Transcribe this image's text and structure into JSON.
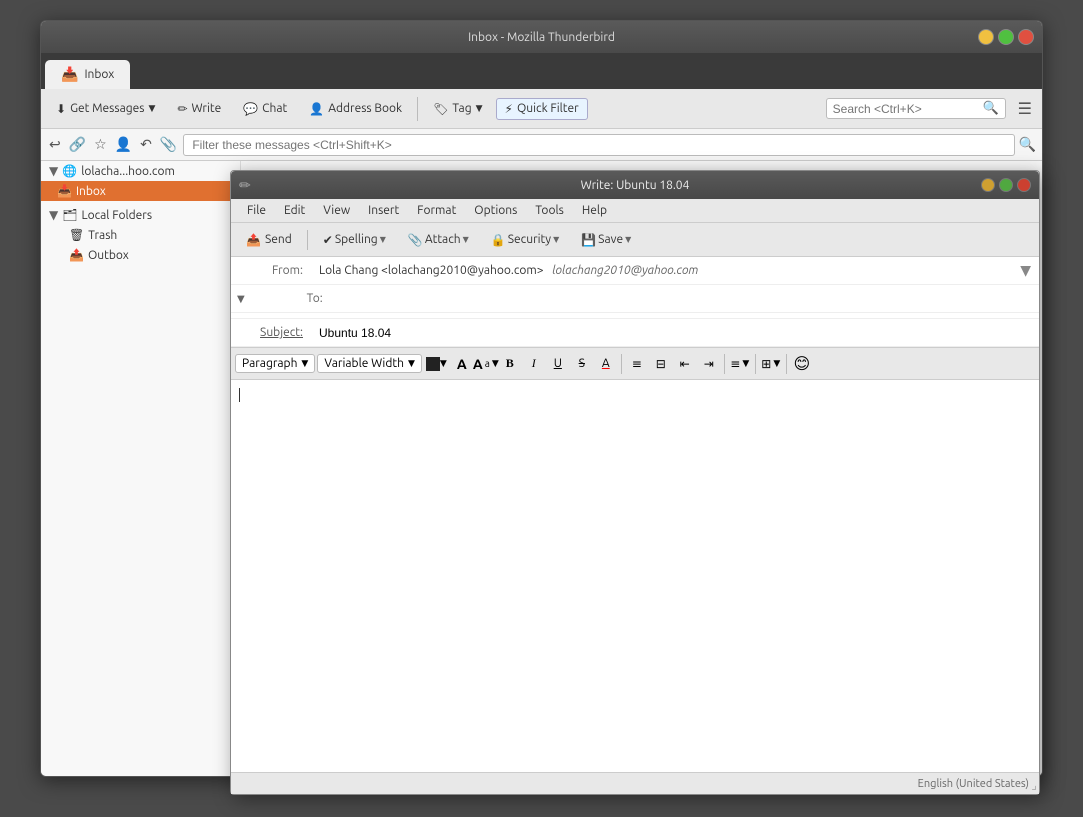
{
  "app": {
    "title": "Inbox - Mozilla Thunderbird",
    "window_controls": {
      "minimize": "–",
      "maximize": "◻",
      "close": "✕"
    }
  },
  "tab": {
    "label": "Inbox",
    "icon": "📥"
  },
  "toolbar": {
    "get_messages": "Get Messages",
    "write": "Write",
    "chat": "Chat",
    "address_book": "Address Book",
    "tag": "Tag",
    "quick_filter": "Quick Filter",
    "search_placeholder": "Search <Ctrl+K>",
    "hamburger": "☰"
  },
  "filterbar": {
    "placeholder": "Filter these messages <Ctrl+Shift+K>"
  },
  "sidebar": {
    "account": "lolacha...hoo.com",
    "inbox": "Inbox",
    "local_folders": "Local Folders",
    "trash": "Trash",
    "outbox": "Outbox"
  },
  "compose": {
    "title": "Write: Ubuntu 18.04",
    "window_controls": {
      "minimize": "–",
      "maximize": "◻",
      "close": "✕"
    },
    "menu": {
      "file": "File",
      "edit": "Edit",
      "view": "View",
      "insert": "Insert",
      "format": "Format",
      "options": "Options",
      "tools": "Tools",
      "help": "Help"
    },
    "toolbar": {
      "send": "Send",
      "spelling": "Spelling",
      "attach": "Attach",
      "security": "Security",
      "save": "Save"
    },
    "from_label": "From:",
    "from_value": "Lola Chang <lolachang2010@yahoo.com>",
    "from_secondary": "lolachang2010@yahoo.com",
    "to_label": "To:",
    "to_value": "",
    "subject_label": "Subject:",
    "subject_value": "Ubuntu 18.04",
    "format_bar": {
      "paragraph": "Paragraph",
      "font": "Variable Width",
      "font_size_icon": "A",
      "bold": "B",
      "italic": "I",
      "underline": "U",
      "strikethrough": "S",
      "color": "A"
    },
    "statusbar": {
      "locale": "English (United States)"
    }
  }
}
